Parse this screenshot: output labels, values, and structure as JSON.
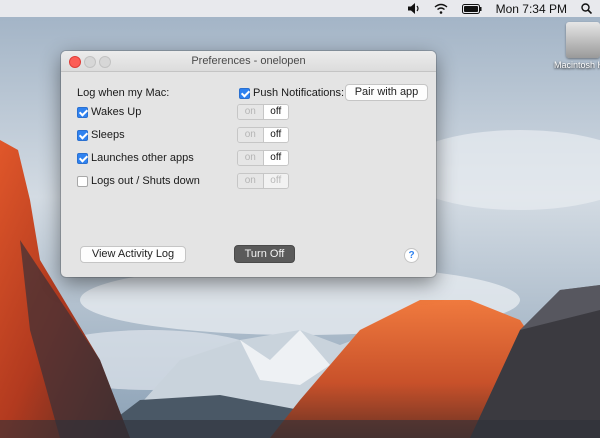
{
  "menubar": {
    "clock": "Mon 7:34 PM",
    "icons": [
      "volume-icon",
      "wifi-icon",
      "battery-icon",
      "spotlight-search-icon"
    ]
  },
  "desktop": {
    "drive_label": "Macintosh HD"
  },
  "window": {
    "title": "Preferences - onelopen",
    "log_heading": "Log when my Mac:",
    "push_label": "Push Notifications:",
    "push_checked": true,
    "pair_button": "Pair with app",
    "events": [
      {
        "label": "Wakes Up",
        "checked": true,
        "on": "on",
        "off": "off"
      },
      {
        "label": "Sleeps",
        "checked": true,
        "on": "on",
        "off": "off"
      },
      {
        "label": "Launches other apps",
        "checked": true,
        "on": "on",
        "off": "off"
      },
      {
        "label": "Logs out / Shuts down",
        "checked": false,
        "on": "on",
        "off": "off"
      }
    ],
    "view_log_button": "View Activity Log",
    "turn_off_button": "Turn Off",
    "help_glyph": "?"
  },
  "colors": {
    "accent": "#2f82f0",
    "close": "#fc5d56",
    "dark_button": "#5a5a5a"
  }
}
